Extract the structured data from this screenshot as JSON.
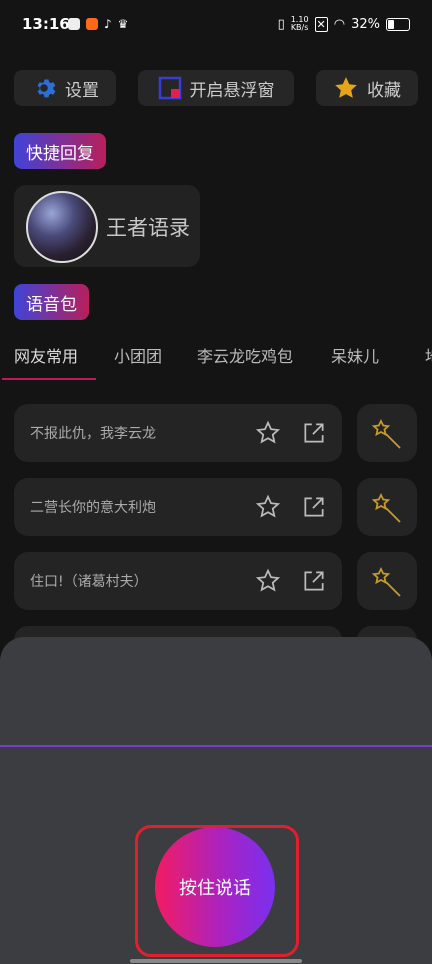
{
  "status": {
    "time": "13:16",
    "speed_value": "1.10",
    "speed_unit": "KB/s",
    "battery": "32%"
  },
  "top_buttons": {
    "settings": "设置",
    "float_window": "开启悬浮窗",
    "favorites": "收藏"
  },
  "sections": {
    "quick_reply": "快捷回复",
    "voice_pack": "语音包"
  },
  "profile": {
    "name": "王者语录"
  },
  "tabs": [
    "网友常用",
    "小团团",
    "李云龙吃鸡包",
    "呆妹儿",
    "地"
  ],
  "phrases": [
    "不报此仇，我李云龙",
    "二营长你的意大利炮",
    "住口!（诸葛村夫）"
  ],
  "talk_button": {
    "label": "按住说话"
  },
  "colors": {
    "accent": "#c2185b",
    "gradient_start": "#f21b63",
    "gradient_end": "#7a30f0",
    "highlight_frame": "#e0202e"
  }
}
